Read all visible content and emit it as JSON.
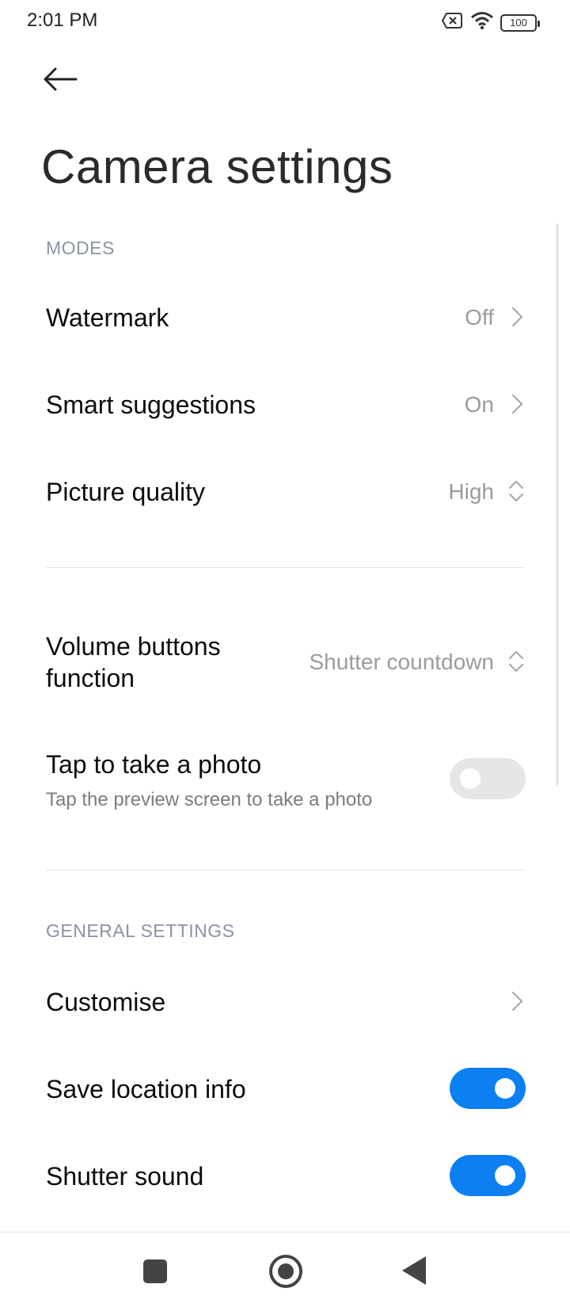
{
  "status_bar": {
    "time": "2:01 PM",
    "battery": "100"
  },
  "page": {
    "title": "Camera settings"
  },
  "sections": {
    "modes_header": "MODES",
    "general_header": "GENERAL SETTINGS"
  },
  "settings": {
    "watermark": {
      "label": "Watermark",
      "value": "Off"
    },
    "smart_suggestions": {
      "label": "Smart suggestions",
      "value": "On"
    },
    "picture_quality": {
      "label": "Picture quality",
      "value": "High"
    },
    "volume_buttons": {
      "label_line1": "Volume buttons",
      "label_line2": "function",
      "value": "Shutter countdown"
    },
    "tap_to_photo": {
      "label": "Tap to take a photo",
      "description": "Tap the preview screen to take a photo",
      "enabled": false
    },
    "customise": {
      "label": "Customise"
    },
    "save_location": {
      "label": "Save location info",
      "enabled": true
    },
    "shutter_sound": {
      "label": "Shutter sound",
      "enabled": true
    }
  },
  "colors": {
    "accent": "#0c7ff2",
    "section_header": "#8a93a6",
    "secondary_text": "#9b9b9b"
  }
}
